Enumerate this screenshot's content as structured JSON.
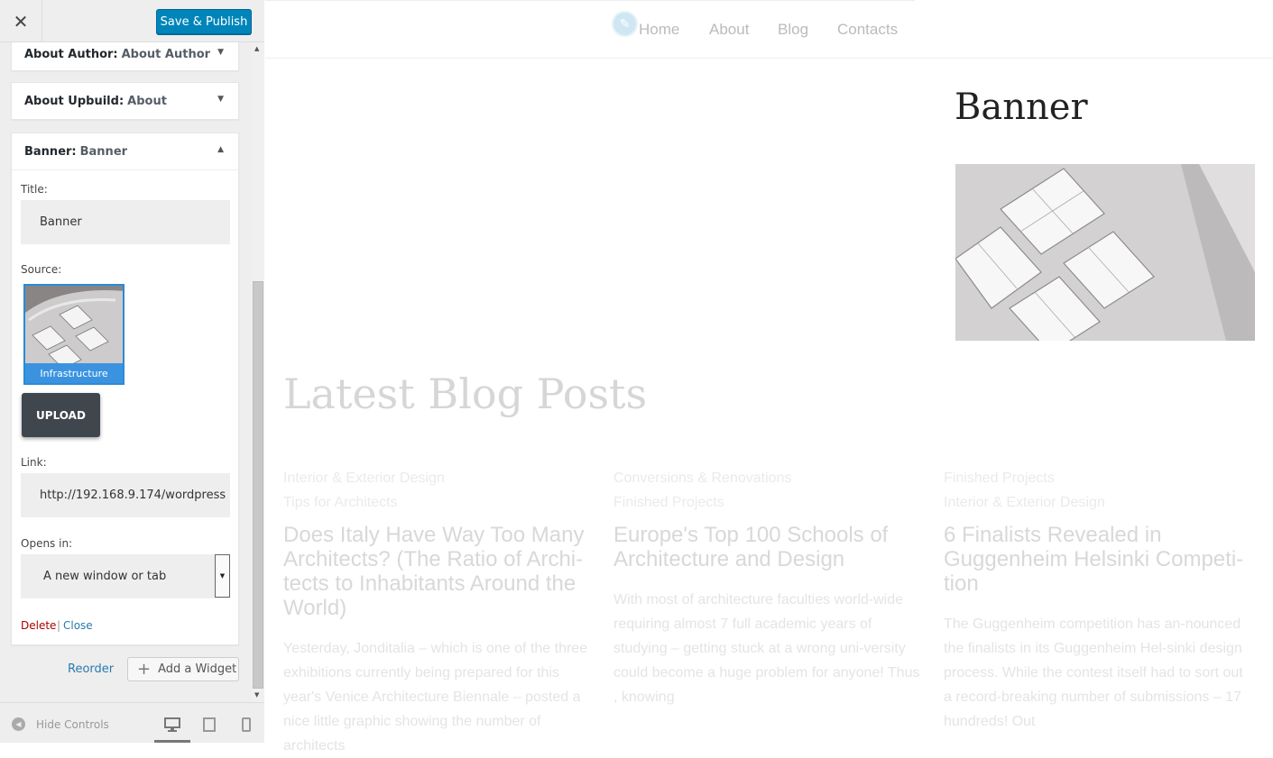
{
  "sidebar": {
    "close_label": "✕",
    "save_label": "Save & Publish",
    "widgets": [
      {
        "name": "About Author",
        "title": "About Author"
      },
      {
        "name": "About Upbuild",
        "title": "About"
      },
      {
        "name": "Banner",
        "title": "Banner"
      }
    ],
    "banner_form": {
      "title_label": "Title:",
      "title_value": "Banner",
      "source_label": "Source:",
      "source_caption": "Infrastructure",
      "upload_label": "UPLOAD",
      "link_label": "Link:",
      "link_value": "http://192.168.9.174/wordpress",
      "opens_label": "Opens in:",
      "opens_value": "A new window or tab",
      "delete_label": "Delete",
      "separator": "|",
      "close_label": "Close"
    },
    "reorder_label": "Reorder",
    "add_widget_label": "Add a Widget",
    "footer": {
      "hide_controls": "Hide Controls"
    }
  },
  "preview": {
    "nav": [
      "Home",
      "About",
      "Blog",
      "Contacts"
    ],
    "banner_title": "Banner",
    "section_title": "Latest Blog Posts",
    "posts": [
      {
        "cats": [
          "Interior & Exterior Design",
          "Tips for Architects"
        ],
        "title": "Does Italy Have Way Too Many Architects? (The Ratio of Archi-tects to Inhabitants Around the World)",
        "excerpt": "Yesterday, Jonditalia – which is one of the three exhibitions currently being prepared for this year's Venice Architecture Biennale – posted a nice little graphic showing the number of architects"
      },
      {
        "cats": [
          "Conversions & Renovations",
          "Finished Projects"
        ],
        "title": "Europe's Top 100 Schools of Architecture and Design",
        "excerpt": "With most of architecture faculties world-wide requiring almost 7 full academic years of studying – getting stuck at a wrong uni-versity could become a huge problem for anyone! Thus , knowing"
      },
      {
        "cats": [
          "Finished Projects",
          "Interior & Exterior Design"
        ],
        "title": "6 Finalists Revealed in Guggenheim Helsinki Competi-tion",
        "excerpt": "The Guggenheim competition has an-nounced the finalists in its Guggenheim Hel-sinki design process. While the contest itself had to sort out a record-breaking number of submissions – 17 hundreds! Out"
      }
    ]
  },
  "colors": {
    "accent": "#0085ba",
    "thumb_border": "#2a8bd8",
    "link": "#2a7aaf",
    "delete": "#a00"
  }
}
